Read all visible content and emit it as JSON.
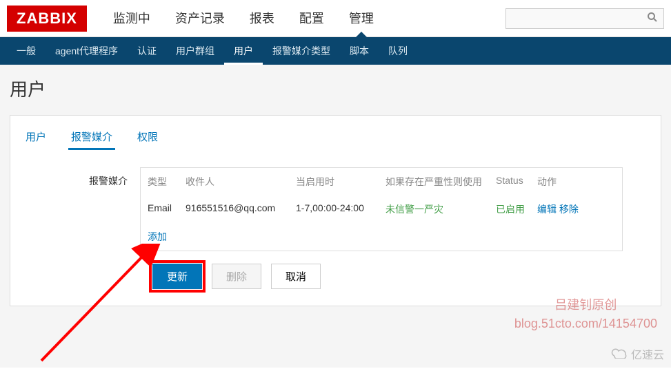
{
  "logo": "ZABBIX",
  "topNav": {
    "items": [
      "监测中",
      "资产记录",
      "报表",
      "配置",
      "管理"
    ],
    "activeIndex": 4
  },
  "subNav": {
    "items": [
      "一般",
      "agent代理程序",
      "认证",
      "用户群组",
      "用户",
      "报警媒介类型",
      "脚本",
      "队列"
    ],
    "activeIndex": 4
  },
  "pageTitle": "用户",
  "tabs": {
    "items": [
      "用户",
      "报警媒介",
      "权限"
    ],
    "activeIndex": 1
  },
  "form": {
    "mediaLabel": "报警媒介",
    "headers": {
      "type": "类型",
      "recipient": "收件人",
      "when": "当启用时",
      "severity": "如果存在严重性则使用",
      "status": "Status",
      "action": "动作"
    },
    "rows": [
      {
        "type": "Email",
        "recipient": "916551516@qq.com",
        "when": "1-7,00:00-24:00",
        "severity": "未信警一严灾",
        "status": "已启用",
        "editLabel": "编辑",
        "removeLabel": "移除"
      }
    ],
    "addLabel": "添加"
  },
  "buttons": {
    "update": "更新",
    "delete": "删除",
    "cancel": "取消"
  },
  "watermark": {
    "line1": "吕建钊原创",
    "line2": "blog.51cto.com/14154700"
  },
  "brandWatermark": "亿速云"
}
